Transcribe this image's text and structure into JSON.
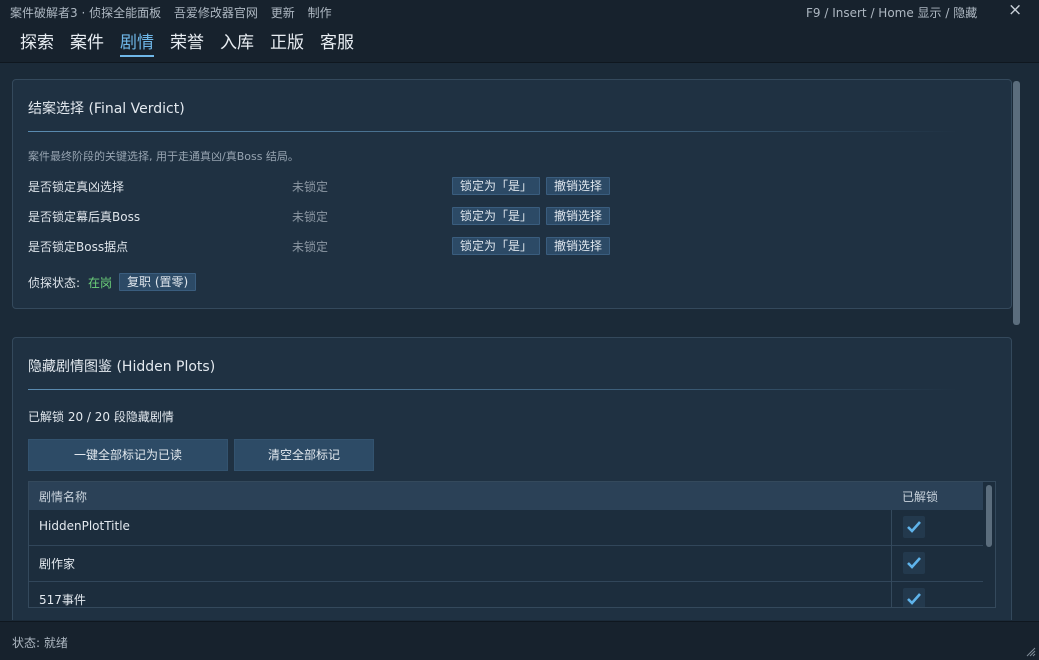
{
  "titlebar": {
    "menu": [
      "案件破解者3 · 侦探全能面板",
      "吾爱修改器官网",
      "更新",
      "制作"
    ],
    "hint": "F9 / Insert / Home  显示 / 隐藏",
    "close": "×"
  },
  "tabs": [
    {
      "label": "探索",
      "active": false
    },
    {
      "label": "案件",
      "active": false
    },
    {
      "label": "剧情",
      "active": true
    },
    {
      "label": "荣誉",
      "active": false
    },
    {
      "label": "入库",
      "active": false
    },
    {
      "label": "正版",
      "active": false
    },
    {
      "label": "客服",
      "active": false
    }
  ],
  "verdict": {
    "title": "结案选择 (Final Verdict)",
    "description": "案件最终阶段的关键选择, 用于走通真凶/真Boss 结局。",
    "rows": [
      {
        "label": "是否锁定真凶选择",
        "status": "未锁定",
        "lock_btn": "锁定为「是」",
        "undo_btn": "撤销选择"
      },
      {
        "label": "是否锁定幕后真Boss",
        "status": "未锁定",
        "lock_btn": "锁定为「是」",
        "undo_btn": "撤销选择"
      },
      {
        "label": "是否锁定Boss据点",
        "status": "未锁定",
        "lock_btn": "锁定为「是」",
        "undo_btn": "撤销选择"
      }
    ],
    "detective_label": "侦探状态:",
    "detective_value": "在岗",
    "reset_btn": "复职 (置零)"
  },
  "hidden_plots": {
    "title": "隐藏剧情图鉴 (Hidden Plots)",
    "unlocked_text": "已解锁 20 / 20 段隐藏剧情",
    "mark_all_btn": "一键全部标记为已读",
    "clear_btn": "清空全部标记",
    "columns": [
      "剧情名称",
      "已解锁"
    ],
    "rows": [
      {
        "name": "HiddenPlotTitle",
        "unlocked": true
      },
      {
        "name": "剧作家",
        "unlocked": true
      },
      {
        "name": "517事件",
        "unlocked": true
      }
    ]
  },
  "statusbar": {
    "text": "状态: 就绪"
  },
  "colors": {
    "accent": "#6fb7e8",
    "ok": "#6cd07a",
    "button": "#2c4a66"
  }
}
